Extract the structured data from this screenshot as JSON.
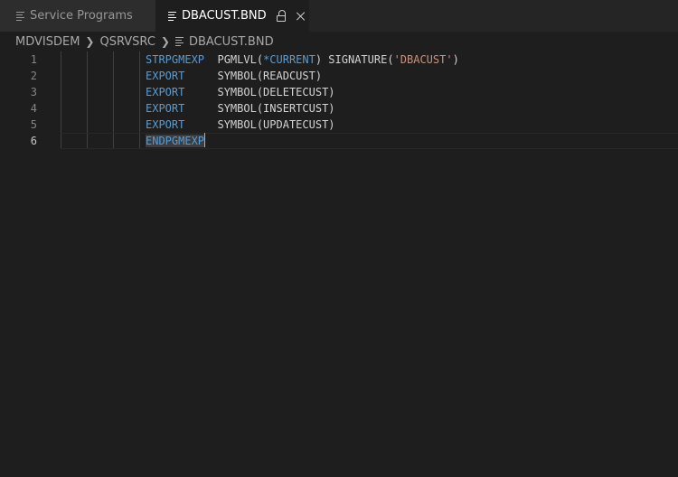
{
  "tabs": [
    {
      "label": "Service Programs",
      "active": false
    },
    {
      "label": "DBACUST.BND",
      "active": true
    }
  ],
  "breadcrumb": [
    "MDVISDEM",
    "QSRVSRC",
    "DBACUST.BND"
  ],
  "editor": {
    "lines": [
      {
        "number": "1",
        "keyword": "STRPGMEXP",
        "rest_a": "  PGMLVL(",
        "star": "*CURRENT",
        "rest_b": ") SIGNATURE(",
        "string": "'DBACUST'",
        "rest_c": ")"
      },
      {
        "number": "2",
        "keyword": "EXPORT",
        "rest": "     SYMBOL(READCUST)"
      },
      {
        "number": "3",
        "keyword": "EXPORT",
        "rest": "     SYMBOL(DELETECUST)"
      },
      {
        "number": "4",
        "keyword": "EXPORT",
        "rest": "     SYMBOL(INSERTCUST)"
      },
      {
        "number": "5",
        "keyword": "EXPORT",
        "rest": "     SYMBOL(UPDATECUST)"
      },
      {
        "number": "6",
        "keyword": "ENDPGMEXP",
        "current": true
      }
    ]
  },
  "colors": {
    "background": "#1e1e1e",
    "keyword": "#569cd6",
    "string": "#ce9178",
    "text": "#d4d4d4",
    "line_number": "#858585"
  }
}
